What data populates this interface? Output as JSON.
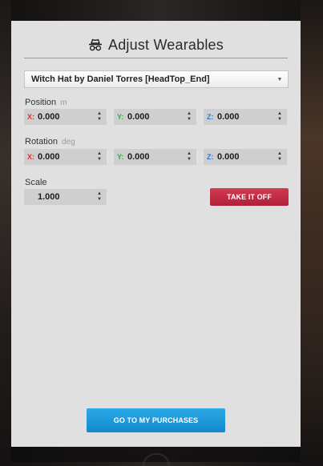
{
  "header": {
    "title": "Adjust Wearables",
    "icon": "spy-hat-icon"
  },
  "wearable_select": {
    "selected": "Witch Hat by Daniel Torres [HeadTop_End]"
  },
  "position": {
    "label": "Position",
    "unit": "m",
    "x": {
      "axis": "X:",
      "value": "0.000"
    },
    "y": {
      "axis": "Y:",
      "value": "0.000"
    },
    "z": {
      "axis": "Z:",
      "value": "0.000"
    }
  },
  "rotation": {
    "label": "Rotation",
    "unit": "deg",
    "x": {
      "axis": "X:",
      "value": "0.000"
    },
    "y": {
      "axis": "Y:",
      "value": "0.000"
    },
    "z": {
      "axis": "Z:",
      "value": "0.000"
    }
  },
  "scale": {
    "label": "Scale",
    "value": "1.000"
  },
  "buttons": {
    "take_off": "TAKE IT OFF",
    "purchases": "GO TO MY PURCHASES"
  },
  "colors": {
    "axis_x": "#e0312f",
    "axis_y": "#2fae3c",
    "axis_z": "#2f78d6",
    "take_off_bg": "#c52b43",
    "purchases_bg": "#1d98dc"
  }
}
